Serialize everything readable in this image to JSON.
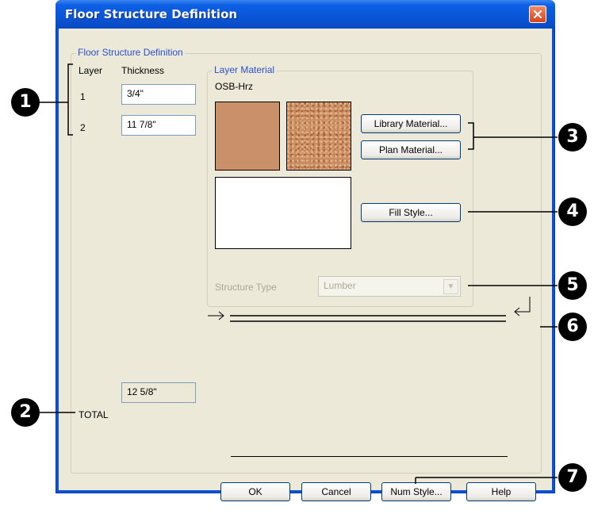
{
  "window": {
    "title": "Floor Structure Definition"
  },
  "group": {
    "label": "Floor Structure Definition"
  },
  "layers": {
    "col_layer": "Layer",
    "col_thickness": "Thickness",
    "rows": [
      {
        "num": "1",
        "thickness": "3/4\""
      },
      {
        "num": "2",
        "thickness": "11 7/8\""
      }
    ],
    "total_label": "TOTAL",
    "total_value": "12 5/8\""
  },
  "layer_material": {
    "label": "Layer Material",
    "material_name": "OSB-Hrz",
    "library_button": "Library Material...",
    "plan_button": "Plan Material...",
    "fill_button": "Fill Style...",
    "structure_type_label": "Structure Type",
    "structure_type_value": "Lumber"
  },
  "buttons": {
    "ok": "OK",
    "cancel": "Cancel",
    "num_style": "Num Style...",
    "help": "Help"
  },
  "callouts": [
    "1",
    "2",
    "3",
    "4",
    "5",
    "6",
    "7"
  ],
  "colors": {
    "title_bar": "#0a55d8",
    "dialog_bg": "#ece9d8",
    "group_label": "#2a4fcf",
    "swatch": "#c9906a"
  },
  "icons": [
    "close-icon",
    "dropdown-arrow-icon",
    "arrow-right-icon",
    "return-arrow-icon"
  ]
}
